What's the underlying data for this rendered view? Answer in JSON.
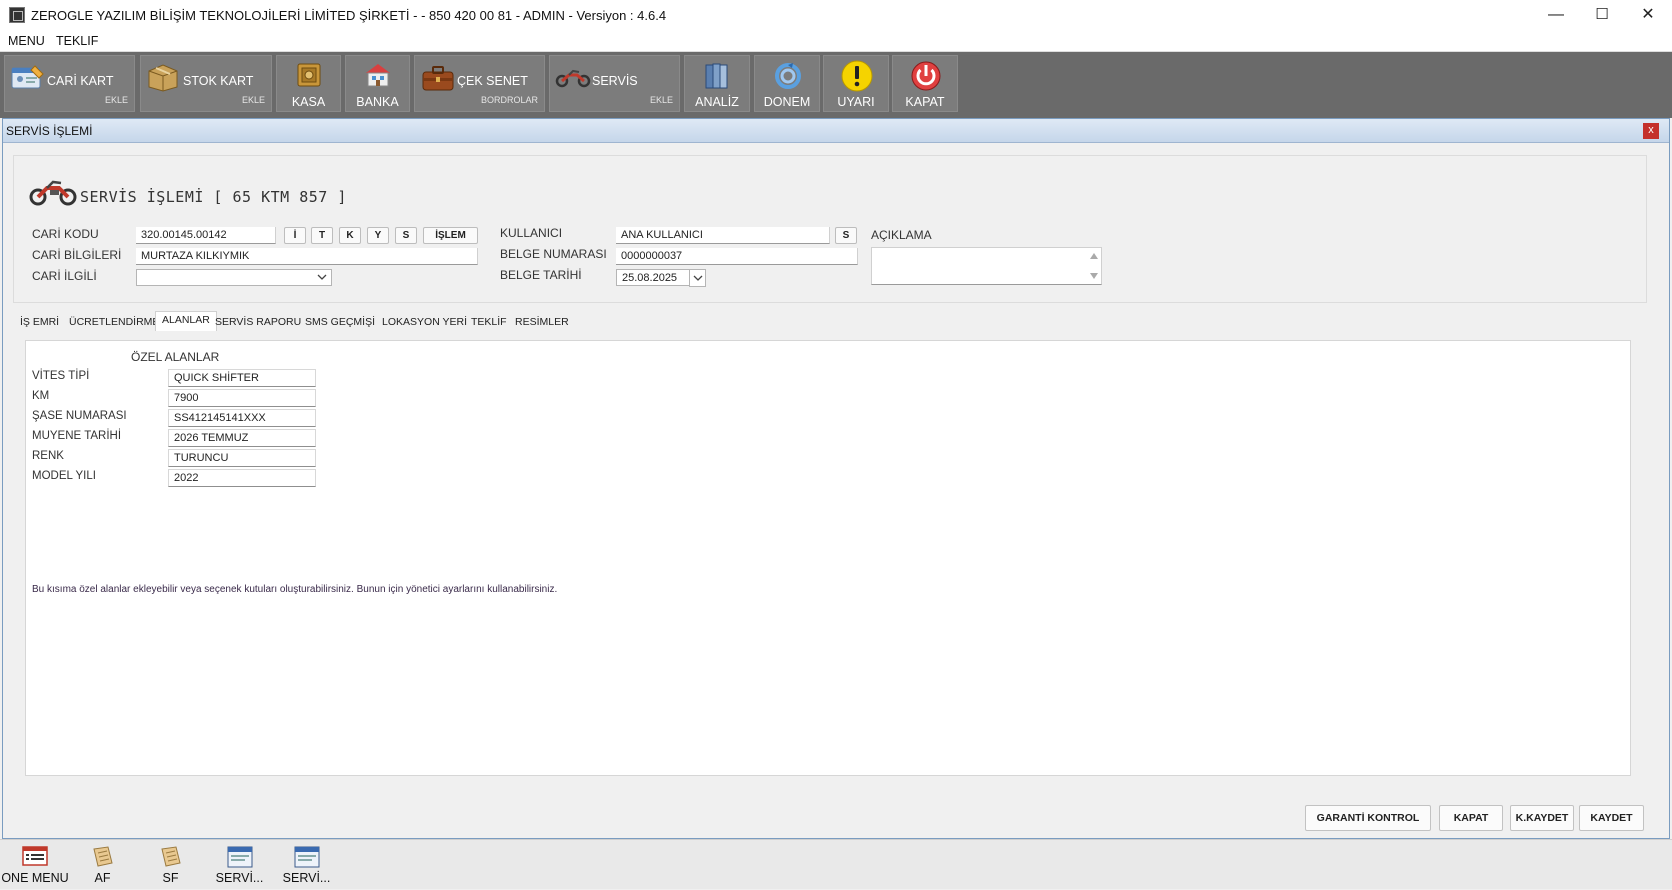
{
  "window": {
    "title": "ZEROGLE YAZILIM BİLİŞİM TEKNOLOJİLERİ LİMİTED ŞİRKETİ -  - 850 420 00 81 - ADMIN -  Versiyon : 4.6.4",
    "minimize": "—",
    "maximize": "☐",
    "close": "✕"
  },
  "menubar": {
    "items": [
      "MENU",
      "TEKLIF"
    ]
  },
  "toolbar": {
    "cari_kart": {
      "label": "CARİ KART",
      "sub": "EKLE"
    },
    "stok_kart": {
      "label": "STOK KART",
      "sub": "EKLE"
    },
    "kasa": "KASA",
    "banka": "BANKA",
    "cek_senet": {
      "label": "ÇEK SENET",
      "sub": "BORDROLAR"
    },
    "servis": {
      "label": "SERVİS",
      "sub": "EKLE"
    },
    "analiz": "ANALİZ",
    "donem": "DONEM",
    "uyari": "UYARI",
    "kapat": "KAPAT"
  },
  "inner": {
    "title": "SERVİS İŞLEMİ",
    "close": "x",
    "heading": "SERVİS İŞLEMİ [ 65 KTM 857 ]",
    "labels": {
      "cari_kodu": "CARİ KODU",
      "cari_bilgileri": "CARİ BİLGİLERİ",
      "cari_ilgili": "CARİ İLGİLİ",
      "kullanici": "KULLANICI",
      "belge_numarasi": "BELGE NUMARASI",
      "belge_tarihi": "BELGE TARİHİ",
      "aciklama": "AÇIKLAMA"
    },
    "values": {
      "cari_kodu": "320.00145.00142",
      "cari_bilgileri": "MURTAZA KILKIYMIK",
      "cari_ilgili": "",
      "kullanici": "ANA KULLANICI",
      "belge_numarasi": "0000000037",
      "belge_tarihi": "25.08.2025",
      "aciklama": ""
    },
    "small_buttons": [
      "İ",
      "T",
      "K",
      "Y",
      "S",
      "İŞLEM"
    ],
    "kullanici_button": "S"
  },
  "tabs": {
    "items": [
      "İŞ EMRİ",
      "ÜCRETLENDİRME",
      "ALANLAR",
      "SERVİS RAPORU",
      "SMS GEÇMİŞİ",
      "LOKASYON YERİ",
      "TEKLİF",
      "RESİMLER"
    ],
    "active": "ALANLAR"
  },
  "alanlar": {
    "header": "ÖZEL ALANLAR",
    "fields": [
      {
        "label": "VİTES TİPİ",
        "value": "QUICK SHİFTER"
      },
      {
        "label": "KM",
        "value": "7900"
      },
      {
        "label": "ŞASE NUMARASI",
        "value": "SS412145141XXX"
      },
      {
        "label": "MUYENE TARİHİ",
        "value": "2026 TEMMUZ"
      },
      {
        "label": "RENK",
        "value": "TURUNCU"
      },
      {
        "label": "MODEL YILI",
        "value": "2022"
      }
    ],
    "note": "Bu kısıma özel alanlar ekleyebilir veya seçenek kutuları oluşturabilirsiniz. Bunun için yönetici ayarlarını kullanabilirsiniz."
  },
  "bottom_buttons": {
    "garanti": "GARANTİ KONTROL",
    "kapat": "KAPAT",
    "kkaydet": "K.KAYDET",
    "kaydet": "KAYDET"
  },
  "taskbar": {
    "items": [
      "ONE MENU",
      "AF",
      "SF",
      "SERVİ...",
      "SERVİ..."
    ]
  },
  "colors": {
    "toolbar_bg": "#6a6a6a",
    "toolbar_button": "#7c7c7c",
    "inner_title": "#c5d6ea",
    "close_red": "#c4302b",
    "warning_yellow": "#f5d300"
  }
}
